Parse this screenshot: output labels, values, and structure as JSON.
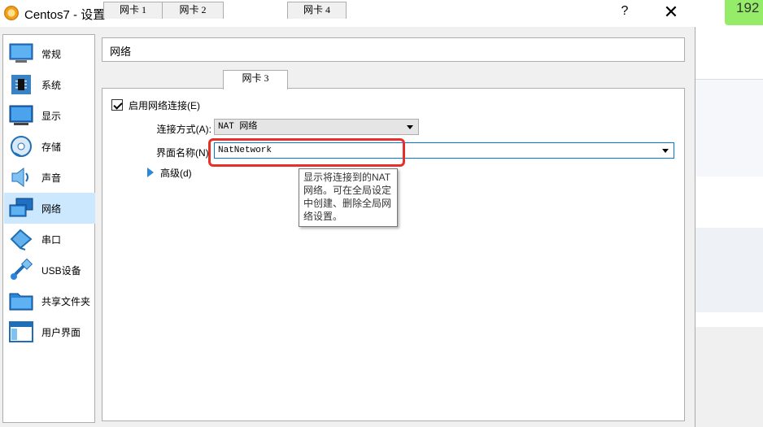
{
  "window": {
    "title": "Centos7 - 设置",
    "help_label": "?",
    "close_label": "✕"
  },
  "background": {
    "badge_text": "192"
  },
  "sidebar": {
    "items": [
      {
        "label": "常规",
        "icon": "general-icon",
        "selected": false
      },
      {
        "label": "系统",
        "icon": "system-chip-icon",
        "selected": false
      },
      {
        "label": "显示",
        "icon": "display-monitor-icon",
        "selected": false
      },
      {
        "label": "存储",
        "icon": "storage-disc-icon",
        "selected": false
      },
      {
        "label": "声音",
        "icon": "audio-speaker-icon",
        "selected": false
      },
      {
        "label": "网络",
        "icon": "network-icon",
        "selected": true
      },
      {
        "label": "串口",
        "icon": "serial-port-icon",
        "selected": false
      },
      {
        "label": "USB设备",
        "icon": "usb-icon",
        "selected": false
      },
      {
        "label": "共享文件夹",
        "icon": "shared-folder-icon",
        "selected": false
      },
      {
        "label": "用户界面",
        "icon": "user-interface-icon",
        "selected": false
      }
    ]
  },
  "main": {
    "section_title": "网络",
    "tabs": [
      {
        "label": "网卡 1",
        "active": false
      },
      {
        "label": "网卡 2",
        "active": false
      },
      {
        "label": "网卡 3",
        "active": true
      },
      {
        "label": "网卡 4",
        "active": false
      }
    ],
    "enable_checkbox": {
      "label": "启用网络连接(E)",
      "checked": true
    },
    "attached_to": {
      "label": "连接方式(A):",
      "value": "NAT 网络"
    },
    "name": {
      "label": "界面名称(N):",
      "value": "NatNetwork"
    },
    "advanced": {
      "label": "高级(d)"
    },
    "tooltip": "显示将连接到的NAT网络。可在全局设定中创建、删除全局网络设置。"
  },
  "colors": {
    "selection": "#cce8ff",
    "highlight": "#e8302a",
    "accent": "#0078d7",
    "badge": "#95ec69"
  }
}
